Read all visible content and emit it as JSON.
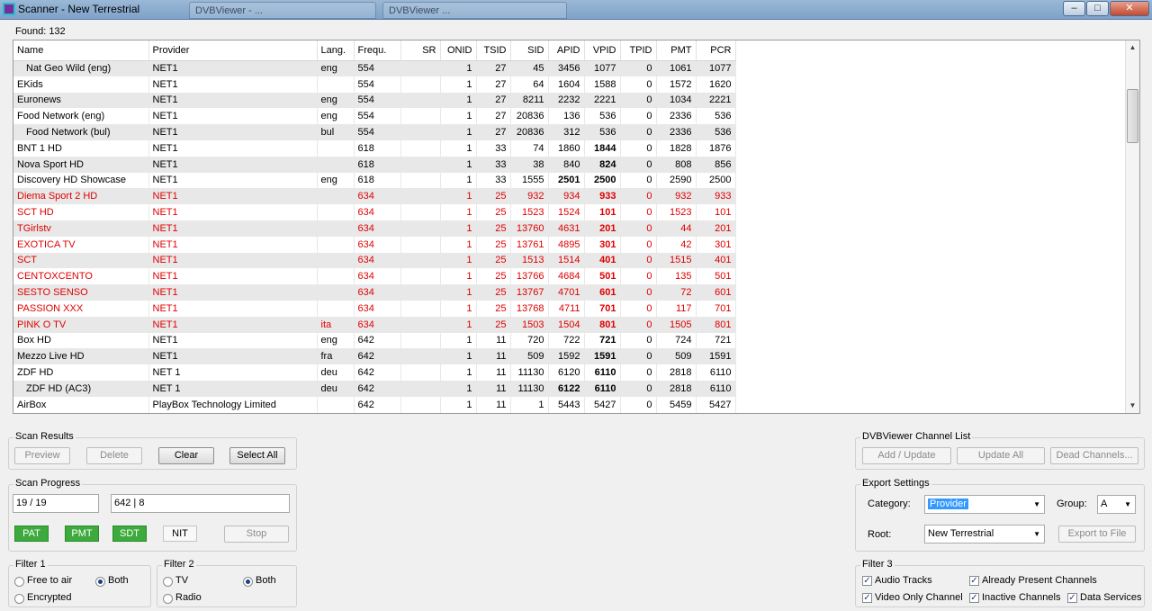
{
  "window": {
    "title": "Scanner - New Terrestrial",
    "background_tabs": [
      "DVBViewer - ...",
      "DVBViewer ..."
    ],
    "controls": {
      "minimize": "–",
      "maximize": "□",
      "close": "✕"
    }
  },
  "found": {
    "label": "Found:",
    "count": "132"
  },
  "table": {
    "columns": [
      "Name",
      "Provider",
      "Lang.",
      "Frequ.",
      "SR",
      "ONID",
      "TSID",
      "SID",
      "APID",
      "VPID",
      "TPID",
      "PMT",
      "PCR"
    ],
    "rows": [
      {
        "name": "Nat Geo Wild (eng)",
        "indent": true,
        "provider": "NET1",
        "lang": "eng",
        "freq": "554",
        "sr": "",
        "onid": "1",
        "tsid": "27",
        "sid": "45",
        "apid": "3456",
        "vpid": "1077",
        "tpid": "0",
        "pmt": "1061",
        "pcr": "1077",
        "red": false,
        "apid_bold": false,
        "vpid_bold": false
      },
      {
        "name": "EKids",
        "indent": false,
        "provider": "NET1",
        "lang": "",
        "freq": "554",
        "sr": "",
        "onid": "1",
        "tsid": "27",
        "sid": "64",
        "apid": "1604",
        "vpid": "1588",
        "tpid": "0",
        "pmt": "1572",
        "pcr": "1620",
        "red": false,
        "apid_bold": false,
        "vpid_bold": false
      },
      {
        "name": "Euronews",
        "indent": false,
        "provider": "NET1",
        "lang": "eng",
        "freq": "554",
        "sr": "",
        "onid": "1",
        "tsid": "27",
        "sid": "8211",
        "apid": "2232",
        "vpid": "2221",
        "tpid": "0",
        "pmt": "1034",
        "pcr": "2221",
        "red": false,
        "apid_bold": false,
        "vpid_bold": false
      },
      {
        "name": "Food Network (eng)",
        "indent": false,
        "provider": "NET1",
        "lang": "eng",
        "freq": "554",
        "sr": "",
        "onid": "1",
        "tsid": "27",
        "sid": "20836",
        "apid": "136",
        "vpid": "536",
        "tpid": "0",
        "pmt": "2336",
        "pcr": "536",
        "red": false,
        "apid_bold": false,
        "vpid_bold": false
      },
      {
        "name": "Food Network (bul)",
        "indent": true,
        "provider": "NET1",
        "lang": "bul",
        "freq": "554",
        "sr": "",
        "onid": "1",
        "tsid": "27",
        "sid": "20836",
        "apid": "312",
        "vpid": "536",
        "tpid": "0",
        "pmt": "2336",
        "pcr": "536",
        "red": false,
        "apid_bold": false,
        "vpid_bold": false
      },
      {
        "name": "BNT 1 HD",
        "indent": false,
        "provider": "NET1",
        "lang": "",
        "freq": "618",
        "sr": "",
        "onid": "1",
        "tsid": "33",
        "sid": "74",
        "apid": "1860",
        "vpid": "1844",
        "tpid": "0",
        "pmt": "1828",
        "pcr": "1876",
        "red": false,
        "apid_bold": false,
        "vpid_bold": true
      },
      {
        "name": "Nova Sport HD",
        "indent": false,
        "provider": "NET1",
        "lang": "",
        "freq": "618",
        "sr": "",
        "onid": "1",
        "tsid": "33",
        "sid": "38",
        "apid": "840",
        "vpid": "824",
        "tpid": "0",
        "pmt": "808",
        "pcr": "856",
        "red": false,
        "apid_bold": false,
        "vpid_bold": true
      },
      {
        "name": "Discovery HD Showcase",
        "indent": false,
        "provider": "NET1",
        "lang": "eng",
        "freq": "618",
        "sr": "",
        "onid": "1",
        "tsid": "33",
        "sid": "1555",
        "apid": "2501",
        "vpid": "2500",
        "tpid": "0",
        "pmt": "2590",
        "pcr": "2500",
        "red": false,
        "apid_bold": true,
        "vpid_bold": true
      },
      {
        "name": "Diema Sport 2 HD",
        "indent": false,
        "provider": "NET1",
        "lang": "",
        "freq": "634",
        "sr": "",
        "onid": "1",
        "tsid": "25",
        "sid": "932",
        "apid": "934",
        "vpid": "933",
        "tpid": "0",
        "pmt": "932",
        "pcr": "933",
        "red": true,
        "apid_bold": false,
        "vpid_bold": true
      },
      {
        "name": "SCT HD",
        "indent": false,
        "provider": "NET1",
        "lang": "",
        "freq": "634",
        "sr": "",
        "onid": "1",
        "tsid": "25",
        "sid": "1523",
        "apid": "1524",
        "vpid": "101",
        "tpid": "0",
        "pmt": "1523",
        "pcr": "101",
        "red": true,
        "apid_bold": false,
        "vpid_bold": true
      },
      {
        "name": "TGirlstv",
        "indent": false,
        "provider": "NET1",
        "lang": "",
        "freq": "634",
        "sr": "",
        "onid": "1",
        "tsid": "25",
        "sid": "13760",
        "apid": "4631",
        "vpid": "201",
        "tpid": "0",
        "pmt": "44",
        "pcr": "201",
        "red": true,
        "apid_bold": false,
        "vpid_bold": true
      },
      {
        "name": "EXOTICA TV",
        "indent": false,
        "provider": "NET1",
        "lang": "",
        "freq": "634",
        "sr": "",
        "onid": "1",
        "tsid": "25",
        "sid": "13761",
        "apid": "4895",
        "vpid": "301",
        "tpid": "0",
        "pmt": "42",
        "pcr": "301",
        "red": true,
        "apid_bold": false,
        "vpid_bold": true
      },
      {
        "name": "SCT",
        "indent": false,
        "provider": "NET1",
        "lang": "",
        "freq": "634",
        "sr": "",
        "onid": "1",
        "tsid": "25",
        "sid": "1513",
        "apid": "1514",
        "vpid": "401",
        "tpid": "0",
        "pmt": "1515",
        "pcr": "401",
        "red": true,
        "apid_bold": false,
        "vpid_bold": true
      },
      {
        "name": "CENTOXCENTO",
        "indent": false,
        "provider": "NET1",
        "lang": "",
        "freq": "634",
        "sr": "",
        "onid": "1",
        "tsid": "25",
        "sid": "13766",
        "apid": "4684",
        "vpid": "501",
        "tpid": "0",
        "pmt": "135",
        "pcr": "501",
        "red": true,
        "apid_bold": false,
        "vpid_bold": true
      },
      {
        "name": "SESTO SENSO",
        "indent": false,
        "provider": "NET1",
        "lang": "",
        "freq": "634",
        "sr": "",
        "onid": "1",
        "tsid": "25",
        "sid": "13767",
        "apid": "4701",
        "vpid": "601",
        "tpid": "0",
        "pmt": "72",
        "pcr": "601",
        "red": true,
        "apid_bold": false,
        "vpid_bold": true
      },
      {
        "name": "PASSION XXX",
        "indent": false,
        "provider": "NET1",
        "lang": "",
        "freq": "634",
        "sr": "",
        "onid": "1",
        "tsid": "25",
        "sid": "13768",
        "apid": "4711",
        "vpid": "701",
        "tpid": "0",
        "pmt": "117",
        "pcr": "701",
        "red": true,
        "apid_bold": false,
        "vpid_bold": true
      },
      {
        "name": "PINK O TV",
        "indent": false,
        "provider": "NET1",
        "lang": "ita",
        "freq": "634",
        "sr": "",
        "onid": "1",
        "tsid": "25",
        "sid": "1503",
        "apid": "1504",
        "vpid": "801",
        "tpid": "0",
        "pmt": "1505",
        "pcr": "801",
        "red": true,
        "apid_bold": false,
        "vpid_bold": true
      },
      {
        "name": "Box HD",
        "indent": false,
        "provider": "NET1",
        "lang": "eng",
        "freq": "642",
        "sr": "",
        "onid": "1",
        "tsid": "11",
        "sid": "720",
        "apid": "722",
        "vpid": "721",
        "tpid": "0",
        "pmt": "724",
        "pcr": "721",
        "red": false,
        "apid_bold": false,
        "vpid_bold": true
      },
      {
        "name": "Mezzo Live HD",
        "indent": false,
        "provider": "NET1",
        "lang": "fra",
        "freq": "642",
        "sr": "",
        "onid": "1",
        "tsid": "11",
        "sid": "509",
        "apid": "1592",
        "vpid": "1591",
        "tpid": "0",
        "pmt": "509",
        "pcr": "1591",
        "red": false,
        "apid_bold": false,
        "vpid_bold": true
      },
      {
        "name": "ZDF HD",
        "indent": false,
        "provider": "NET 1",
        "lang": "deu",
        "freq": "642",
        "sr": "",
        "onid": "1",
        "tsid": "11",
        "sid": "11130",
        "apid": "6120",
        "vpid": "6110",
        "tpid": "0",
        "pmt": "2818",
        "pcr": "6110",
        "red": false,
        "apid_bold": false,
        "vpid_bold": true
      },
      {
        "name": "ZDF HD (AC3)",
        "indent": true,
        "provider": "NET 1",
        "lang": "deu",
        "freq": "642",
        "sr": "",
        "onid": "1",
        "tsid": "11",
        "sid": "11130",
        "apid": "6122",
        "vpid": "6110",
        "tpid": "0",
        "pmt": "2818",
        "pcr": "6110",
        "red": false,
        "apid_bold": true,
        "vpid_bold": true
      },
      {
        "name": "AirBox",
        "indent": false,
        "provider": "PlayBox Technology Limited",
        "lang": "",
        "freq": "642",
        "sr": "",
        "onid": "1",
        "tsid": "11",
        "sid": "1",
        "apid": "5443",
        "vpid": "5427",
        "tpid": "0",
        "pmt": "5459",
        "pcr": "5427",
        "red": false,
        "apid_bold": false,
        "vpid_bold": false
      }
    ]
  },
  "scan_results": {
    "title": "Scan Results",
    "preview": "Preview",
    "delete": "Delete",
    "clear": "Clear",
    "select_all": "Select All"
  },
  "dvbviewer": {
    "title": "DVBViewer Channel List",
    "add_update": "Add / Update",
    "update_all": "Update All",
    "dead_channels": "Dead Channels..."
  },
  "scan_progress": {
    "title": "Scan Progress",
    "counter": "19 / 19",
    "status": "642 | 8",
    "pat": "PAT",
    "pmt": "PMT",
    "sdt": "SDT",
    "nit": "NIT",
    "stop": "Stop"
  },
  "export_settings": {
    "title": "Export Settings",
    "category_label": "Category:",
    "category_value": "Provider",
    "group_label": "Group:",
    "group_value": "A",
    "root_label": "Root:",
    "root_value": "New Terrestrial",
    "export_button": "Export to File"
  },
  "filter1": {
    "title": "Filter 1",
    "free_to_air": "Free to air",
    "both": "Both",
    "encrypted": "Encrypted",
    "selected": "Both"
  },
  "filter2": {
    "title": "Filter 2",
    "tv": "TV",
    "both": "Both",
    "radio": "Radio",
    "selected": "Both"
  },
  "filter3": {
    "title": "Filter 3",
    "audio_tracks": "Audio Tracks",
    "already_present": "Already Present Channels",
    "video_only": "Video Only Channel",
    "inactive": "Inactive Channels",
    "data_services": "Data Services"
  },
  "colors": {
    "inactive_row": "#e00000",
    "indicator_on": "#3caa3c",
    "selection": "#3399ff"
  }
}
